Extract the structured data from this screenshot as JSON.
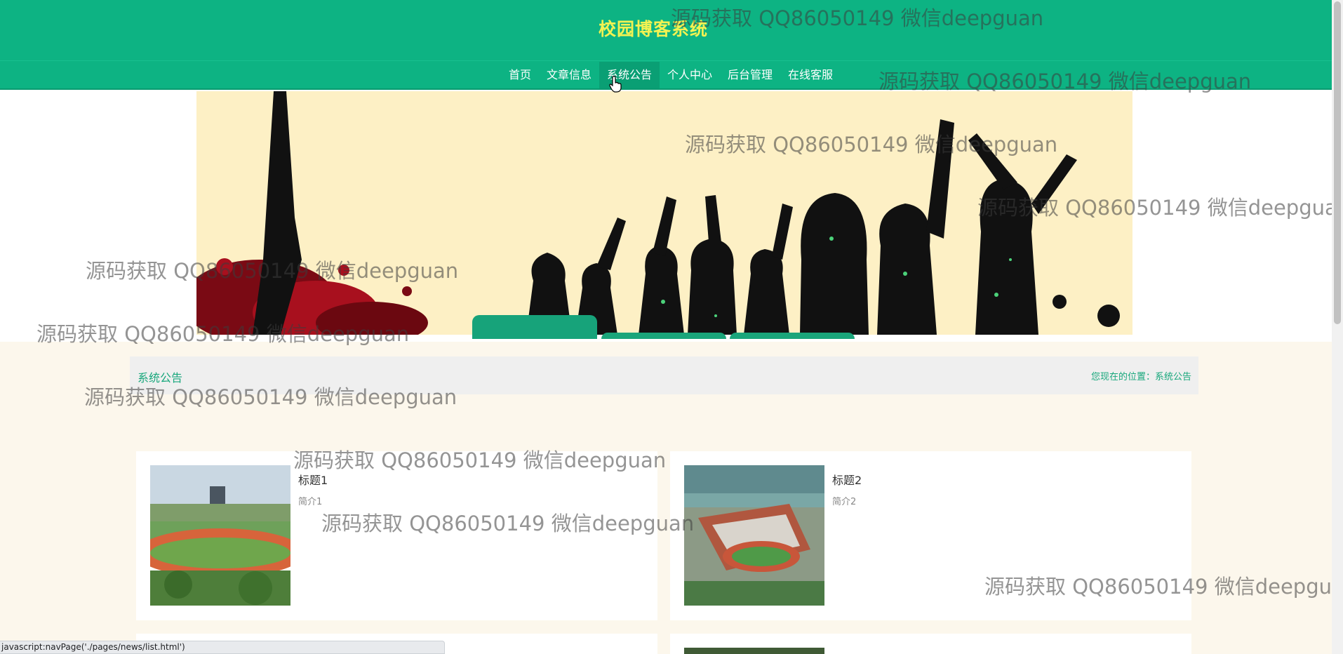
{
  "header": {
    "site_title": "校园博客系统",
    "nav": [
      {
        "label": "首页"
      },
      {
        "label": "文章信息"
      },
      {
        "label": "系统公告",
        "active": true
      },
      {
        "label": "个人中心"
      },
      {
        "label": "后台管理"
      },
      {
        "label": "在线客服"
      }
    ]
  },
  "breadcrumb": {
    "title": "系统公告",
    "location": "您现在的位置：系统公告"
  },
  "news": [
    {
      "title": "标题1",
      "summary": "简介1"
    },
    {
      "title": "标题2",
      "summary": "简介2"
    }
  ],
  "status_bar": "javascript:navPage('./pages/news/list.html')",
  "watermark": "源码获取 QQ86050149 微信deepguan",
  "colors": {
    "header_bg": "#0db383",
    "title_yellow": "#f2f252",
    "accent_green": "#18a77c",
    "section_bg": "#fcf7ec",
    "banner_bg": "#fdf0c5"
  }
}
